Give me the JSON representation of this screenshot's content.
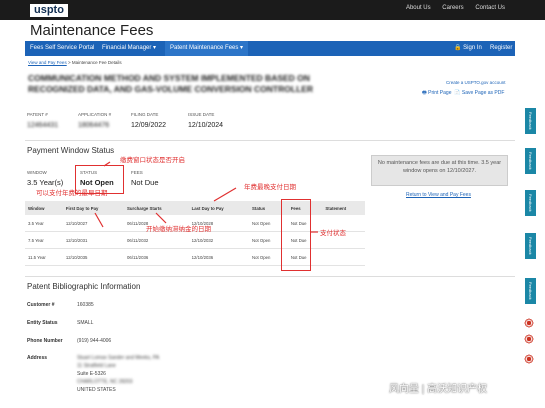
{
  "header": {
    "logo": "uspto",
    "links": [
      "About Us",
      "Careers",
      "Contact Us"
    ],
    "app_title": "Maintenance Fees"
  },
  "nav": {
    "items": [
      "Fees Self Service Portal",
      "Financial Manager ▾",
      "Patent Maintenance Fees ▾"
    ],
    "signin": "Sign In",
    "register": "Register"
  },
  "breadcrumb": {
    "home": "View and Pay Fees",
    "sep": " > ",
    "current": "Maintenance Fee Details"
  },
  "patent": {
    "title": "COMMUNICATION METHOD AND SYSTEM IMPLEMENTED BASED ON RECOGNIZED DATA, AND GAS-VOLUME CONVERSION CONTROLLER",
    "number_label": "PATENT #",
    "number": "12464431",
    "app_label": "APPLICATION #",
    "app": "18064476",
    "filing_label": "FILING DATE",
    "filing": "12/09/2022",
    "issue_label": "ISSUE DATE",
    "issue": "12/10/2024",
    "applink": "Create a USPTO.gov account",
    "print": "Print Page",
    "pdf": "Save Page as PDF"
  },
  "window": {
    "heading": "Payment Window Status",
    "window_label": "WINDOW",
    "window_value": "3.5 Year(s)",
    "status_label": "STATUS",
    "status_value": "Not Open",
    "fees_label": "FEES",
    "fees_value": "Not Due",
    "info": "No maintenance fees are due at this time. 3.5 year window opens on 12/10/2027.",
    "return_link": "Return to View and Pay Fees"
  },
  "table": {
    "headers": [
      "Window",
      "First Day to Pay",
      "Surcharge Starts",
      "Last Day to Pay",
      "Status",
      "Fees",
      "Statement"
    ],
    "rows": [
      [
        "3.5 Year",
        "12/10/2027",
        "06/11/2028",
        "12/10/2028",
        "Not Open",
        "Not Due",
        ""
      ],
      [
        "7.5 Year",
        "12/10/2031",
        "06/11/2032",
        "12/10/2032",
        "Not Open",
        "Not Due",
        ""
      ],
      [
        "11.5 Year",
        "12/10/2035",
        "06/11/2036",
        "12/10/2036",
        "Not Open",
        "Not Due",
        ""
      ]
    ]
  },
  "annotations": {
    "status": "缴费窗口状态是否开启",
    "first_day": "可以支付年费的最早日期",
    "surcharge": "开始缴纳滞纳金的日期",
    "last_day": "年费最晚支付日期",
    "fees": "支付状态"
  },
  "bib": {
    "heading": "Patent Bibliographic Information",
    "customer_label": "Customer #",
    "customer": "160385",
    "entity_label": "Entity Status",
    "entity": "SMALL",
    "phone_label": "Phone Number",
    "phone": "(919) 944-4006",
    "address_label": "Address",
    "address": [
      "Stuart Lomax Sander and Meeks, PA",
      "11 Stratfield Lane",
      "Suite E-5326",
      "CHARLOTTE, NC 28203",
      "UNITED STATES"
    ]
  },
  "sidebar": {
    "feedback": "Feedback"
  },
  "watermark": "风向量 | 高沃知识产权",
  "colors": {
    "nav": "#1c63b7",
    "topbar": "#1b1b1b",
    "annotation": "#e03030",
    "feedback": "#1b87a6"
  }
}
